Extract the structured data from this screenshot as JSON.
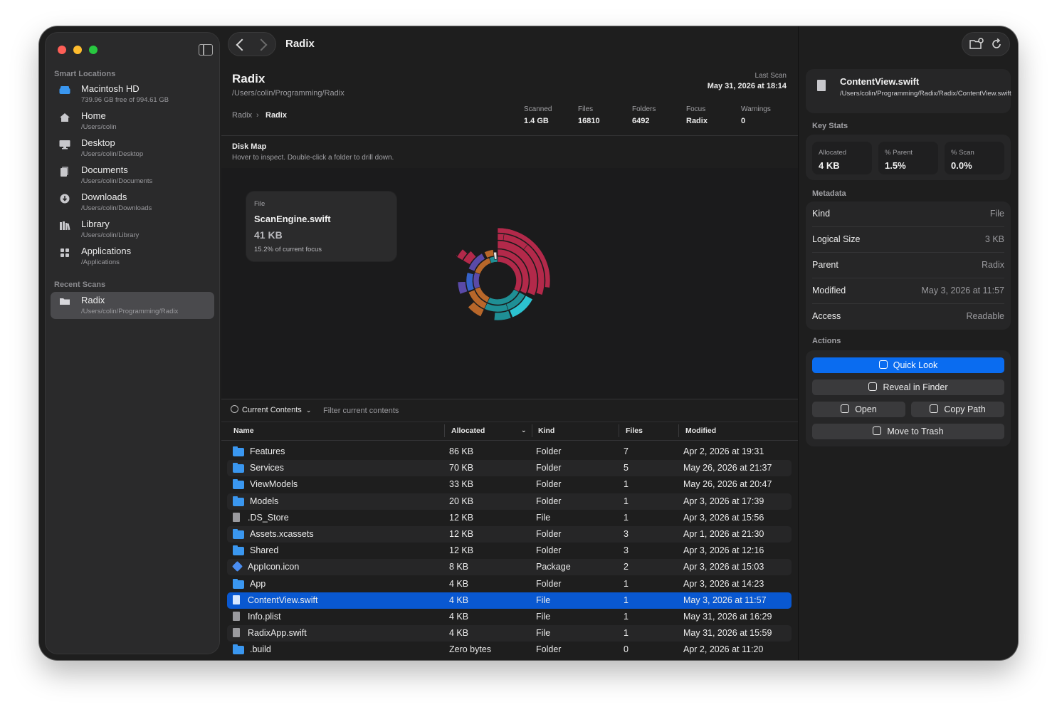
{
  "window": {
    "toolbar_title": "Radix"
  },
  "sidebar": {
    "smart_label": "Smart Locations",
    "smart_items": [
      {
        "title": "Macintosh HD",
        "subtitle": "739.96 GB free of 994.61 GB",
        "icon": "drive-icon"
      },
      {
        "title": "Home",
        "subtitle": "/Users/colin",
        "icon": "house-icon"
      },
      {
        "title": "Desktop",
        "subtitle": "/Users/colin/Desktop",
        "icon": "desktop-icon"
      },
      {
        "title": "Documents",
        "subtitle": "/Users/colin/Documents",
        "icon": "documents-icon"
      },
      {
        "title": "Downloads",
        "subtitle": "/Users/colin/Downloads",
        "icon": "download-icon"
      },
      {
        "title": "Library",
        "subtitle": "/Users/colin/Library",
        "icon": "library-icon"
      },
      {
        "title": "Applications",
        "subtitle": "/Applications",
        "icon": "apps-grid-icon"
      }
    ],
    "recent_label": "Recent Scans",
    "recent_items": [
      {
        "title": "Radix",
        "subtitle": "/Users/colin/Programming/Radix",
        "icon": "folder-icon"
      }
    ]
  },
  "header": {
    "title": "Radix",
    "path": "/Users/colin/Programming/Radix",
    "last_scan_label": "Last Scan",
    "last_scan_value": "May 31, 2026 at 18:14",
    "breadcrumb": [
      "Radix",
      "Radix"
    ],
    "stats": [
      {
        "label": "Scanned",
        "value": "1.4 GB"
      },
      {
        "label": "Files",
        "value": "16810"
      },
      {
        "label": "Folders",
        "value": "6492"
      },
      {
        "label": "Focus",
        "value": "Radix"
      },
      {
        "label": "Warnings",
        "value": "0"
      }
    ]
  },
  "disk_map": {
    "title": "Disk Map",
    "subtitle": "Hover to inspect. Double-click a folder to drill down.",
    "tooltip": {
      "kind": "File",
      "name": "ScanEngine.swift",
      "size": "41 KB",
      "percent": "15.2% of current focus"
    },
    "colors": {
      "crimson": "#b3294a",
      "teal": "#1f8f95",
      "cyan": "#2cc2cf",
      "orange": "#b8672a",
      "purple": "#5a4aa8",
      "blue": "#3562c9"
    }
  },
  "filter": {
    "scope_label": "Current Contents",
    "placeholder": "Filter current contents"
  },
  "table": {
    "columns": [
      "Name",
      "Allocated",
      "Kind",
      "Files",
      "Modified"
    ],
    "rows": [
      {
        "name": "Features",
        "allocated": "86 KB",
        "kind": "Folder",
        "files": "7",
        "modified": "Apr 2, 2026 at 19:31",
        "icon": "folder"
      },
      {
        "name": "Services",
        "allocated": "70 KB",
        "kind": "Folder",
        "files": "5",
        "modified": "May 26, 2026 at 21:37",
        "icon": "folder"
      },
      {
        "name": "ViewModels",
        "allocated": "33 KB",
        "kind": "Folder",
        "files": "1",
        "modified": "May 26, 2026 at 20:47",
        "icon": "folder"
      },
      {
        "name": "Models",
        "allocated": "20 KB",
        "kind": "Folder",
        "files": "1",
        "modified": "Apr 3, 2026 at 17:39",
        "icon": "folder"
      },
      {
        "name": ".DS_Store",
        "allocated": "12 KB",
        "kind": "File",
        "files": "1",
        "modified": "Apr 3, 2026 at 15:56",
        "icon": "file"
      },
      {
        "name": "Assets.xcassets",
        "allocated": "12 KB",
        "kind": "Folder",
        "files": "3",
        "modified": "Apr 1, 2026 at 21:30",
        "icon": "folder"
      },
      {
        "name": "Shared",
        "allocated": "12 KB",
        "kind": "Folder",
        "files": "3",
        "modified": "Apr 3, 2026 at 12:16",
        "icon": "folder"
      },
      {
        "name": "AppIcon.icon",
        "allocated": "8 KB",
        "kind": "Package",
        "files": "2",
        "modified": "Apr 3, 2026 at 15:03",
        "icon": "package"
      },
      {
        "name": "App",
        "allocated": "4 KB",
        "kind": "Folder",
        "files": "1",
        "modified": "Apr 3, 2026 at 14:23",
        "icon": "folder"
      },
      {
        "name": "ContentView.swift",
        "allocated": "4 KB",
        "kind": "File",
        "files": "1",
        "modified": "May 3, 2026 at 11:57",
        "icon": "file",
        "selected": true
      },
      {
        "name": "Info.plist",
        "allocated": "4 KB",
        "kind": "File",
        "files": "1",
        "modified": "May 31, 2026 at 16:29",
        "icon": "file"
      },
      {
        "name": "RadixApp.swift",
        "allocated": "4 KB",
        "kind": "File",
        "files": "1",
        "modified": "May 31, 2026 at 15:59",
        "icon": "file"
      },
      {
        "name": ".build",
        "allocated": "Zero bytes",
        "kind": "Folder",
        "files": "0",
        "modified": "Apr 2, 2026 at 11:20",
        "icon": "folder"
      }
    ]
  },
  "inspector": {
    "name": "ContentView.swift",
    "path": "/Users/colin/Programming/Radix/Radix/ContentView.swift",
    "key_stats_label": "Key Stats",
    "key_stats": [
      {
        "label": "Allocated",
        "value": "4 KB"
      },
      {
        "label": "% Parent",
        "value": "1.5%"
      },
      {
        "label": "% Scan",
        "value": "0.0%"
      }
    ],
    "metadata_label": "Metadata",
    "metadata": [
      {
        "key": "Kind",
        "value": "File"
      },
      {
        "key": "Logical Size",
        "value": "3 KB"
      },
      {
        "key": "Parent",
        "value": "Radix"
      },
      {
        "key": "Modified",
        "value": "May 3, 2026 at 11:57"
      },
      {
        "key": "Access",
        "value": "Readable"
      }
    ],
    "actions_label": "Actions",
    "actions": {
      "quick_look": "Quick Look",
      "reveal": "Reveal in Finder",
      "open": "Open",
      "copy_path": "Copy Path",
      "trash": "Move to Trash"
    }
  }
}
